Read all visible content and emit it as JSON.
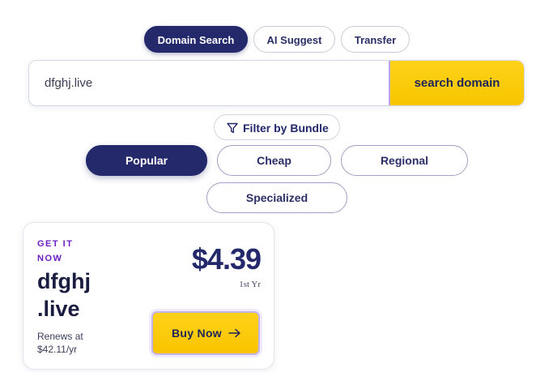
{
  "mode_tabs": [
    {
      "label": "Domain Search",
      "active": true
    },
    {
      "label": "AI Suggest",
      "active": false
    },
    {
      "label": "Transfer",
      "active": false
    }
  ],
  "search": {
    "value": "dfghj.live",
    "button_label": "search domain"
  },
  "filter": {
    "label": "Filter by Bundle",
    "icon": "filter-icon"
  },
  "bundles": [
    {
      "label": "Popular",
      "active": true
    },
    {
      "label": "Cheap",
      "active": false
    },
    {
      "label": "Regional",
      "active": false
    },
    {
      "label": "Specialized",
      "active": false
    }
  ],
  "result_card": {
    "eyebrow": "GET IT NOW",
    "domain_name": "dfghj",
    "domain_tld": ".live",
    "renewal": "Renews at $42.11/yr",
    "price": "$4.39",
    "period": "1st Yr",
    "buy_label": "Buy Now",
    "buy_icon": "arrow-right-icon"
  },
  "colors": {
    "navy": "#24296b",
    "yellow": "#ffd21a",
    "purple": "#6a1fc2"
  }
}
